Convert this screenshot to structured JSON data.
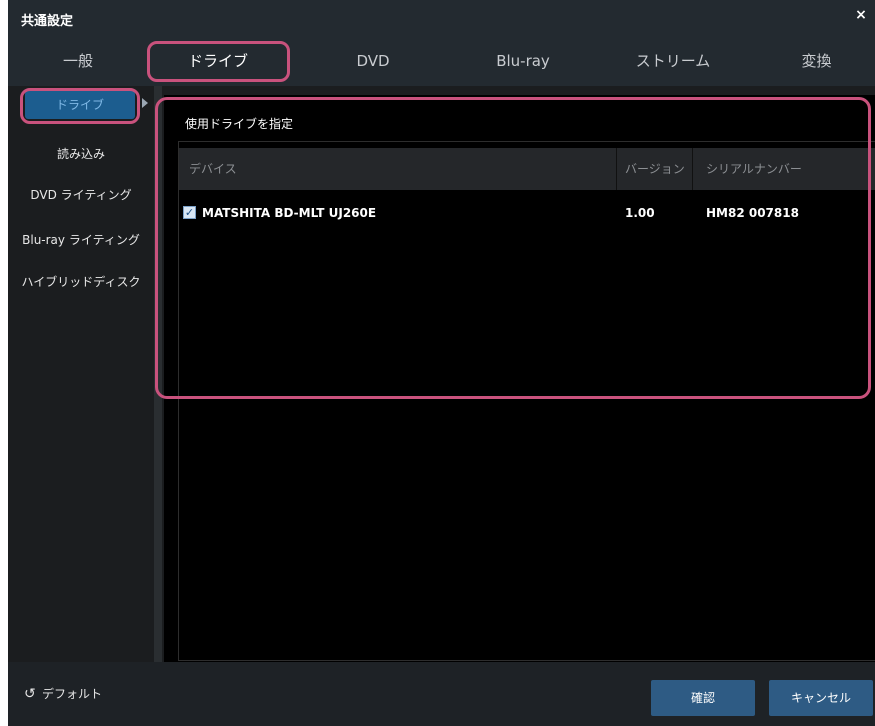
{
  "window": {
    "title": "共通設定",
    "close_symbol": "×"
  },
  "tabs": [
    {
      "label": "一般"
    },
    {
      "label": "ドライブ"
    },
    {
      "label": "DVD"
    },
    {
      "label": "Blu-ray"
    },
    {
      "label": "ストリーム"
    },
    {
      "label": "変換"
    }
  ],
  "sidebar": {
    "items": [
      {
        "label": "ドライブ"
      },
      {
        "label": "読み込み"
      },
      {
        "label": "DVD ライティング"
      },
      {
        "label": "Blu-ray ライティング"
      },
      {
        "label": "ハイブリッドディスク"
      }
    ]
  },
  "main": {
    "section_title": "使用ドライブを指定",
    "table": {
      "columns": [
        "デバイス",
        "バージョン",
        "シリアルナンバー"
      ],
      "rows": [
        {
          "checked": "✓",
          "device": "MATSHITA BD-MLT UJ260E",
          "version": "1.00",
          "serial": "HM82 007818"
        }
      ]
    }
  },
  "footer": {
    "default_icon": "↺",
    "default_label": "デフォルト",
    "ok_label": "確認",
    "cancel_label": "キャンセル"
  },
  "colors": {
    "accent": "#2e5b84",
    "highlight": "#c9527d",
    "active_side": "#1c5d8f"
  },
  "icons": {
    "close": "close-icon",
    "checkbox": "checkbox-checked-icon",
    "default": "reset-icon",
    "side_arrow": "arrow-right-icon"
  }
}
